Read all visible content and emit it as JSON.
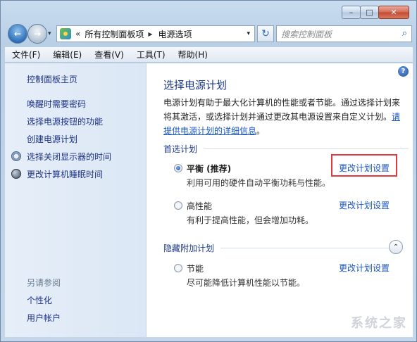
{
  "window": {
    "controls": {
      "minimize": "–",
      "maximize": "□",
      "close": "✕"
    }
  },
  "nav": {
    "back_icon": "←",
    "forward_icon": "→",
    "history_dropdown": "▾",
    "address": {
      "overflow": "«",
      "crumbs": [
        "所有控制面板项",
        "电源选项"
      ],
      "separator": "▶",
      "dropdown": "▾"
    },
    "refresh_icon": "↻",
    "search": {
      "placeholder": "搜索控制面板",
      "icon": "⌕"
    }
  },
  "menu": [
    "文件(F)",
    "编辑(E)",
    "查看(V)",
    "工具(T)",
    "帮助(H)"
  ],
  "sidebar": {
    "home": "控制面板主页",
    "tasks": [
      "唤醒时需要密码",
      "选择电源按钮的功能",
      "创建电源计划",
      "选择关闭显示器的时间",
      "更改计算机睡眠时间"
    ],
    "see_also_title": "另请参阅",
    "see_also": [
      "个性化",
      "用户帐户"
    ]
  },
  "main": {
    "help_icon": "?",
    "title": "选择电源计划",
    "intro_line1": "电源计划有助于最大化计算机的性能或者节能。通过选择计划来",
    "intro_line2_a": "将其激活，或选择计划并通过更改其电源设置来自定义计划。",
    "intro_link_a": "请",
    "intro_link_b": "提供电源计划的详细信息",
    "intro_end": "。",
    "preferred_heading": "首选计划",
    "hidden_heading": "隐藏附加计划",
    "collapse_icon": "⌃",
    "plans": [
      {
        "name": "平衡 (推荐)",
        "desc": "利用可用的硬件自动平衡功耗与性能。",
        "selected": true,
        "link": "更改计划设置"
      },
      {
        "name": "高性能",
        "desc": "有利于提高性能，但会增加功耗。",
        "selected": false,
        "link": "更改计划设置"
      },
      {
        "name": "节能",
        "desc": "尽可能降低计算机性能以节能。",
        "selected": false,
        "link": "更改计划设置"
      }
    ]
  },
  "watermark": "系统之家",
  "colors": {
    "highlight": "#e0393e",
    "link": "#1b57c4",
    "heading": "#1e3a8a"
  }
}
